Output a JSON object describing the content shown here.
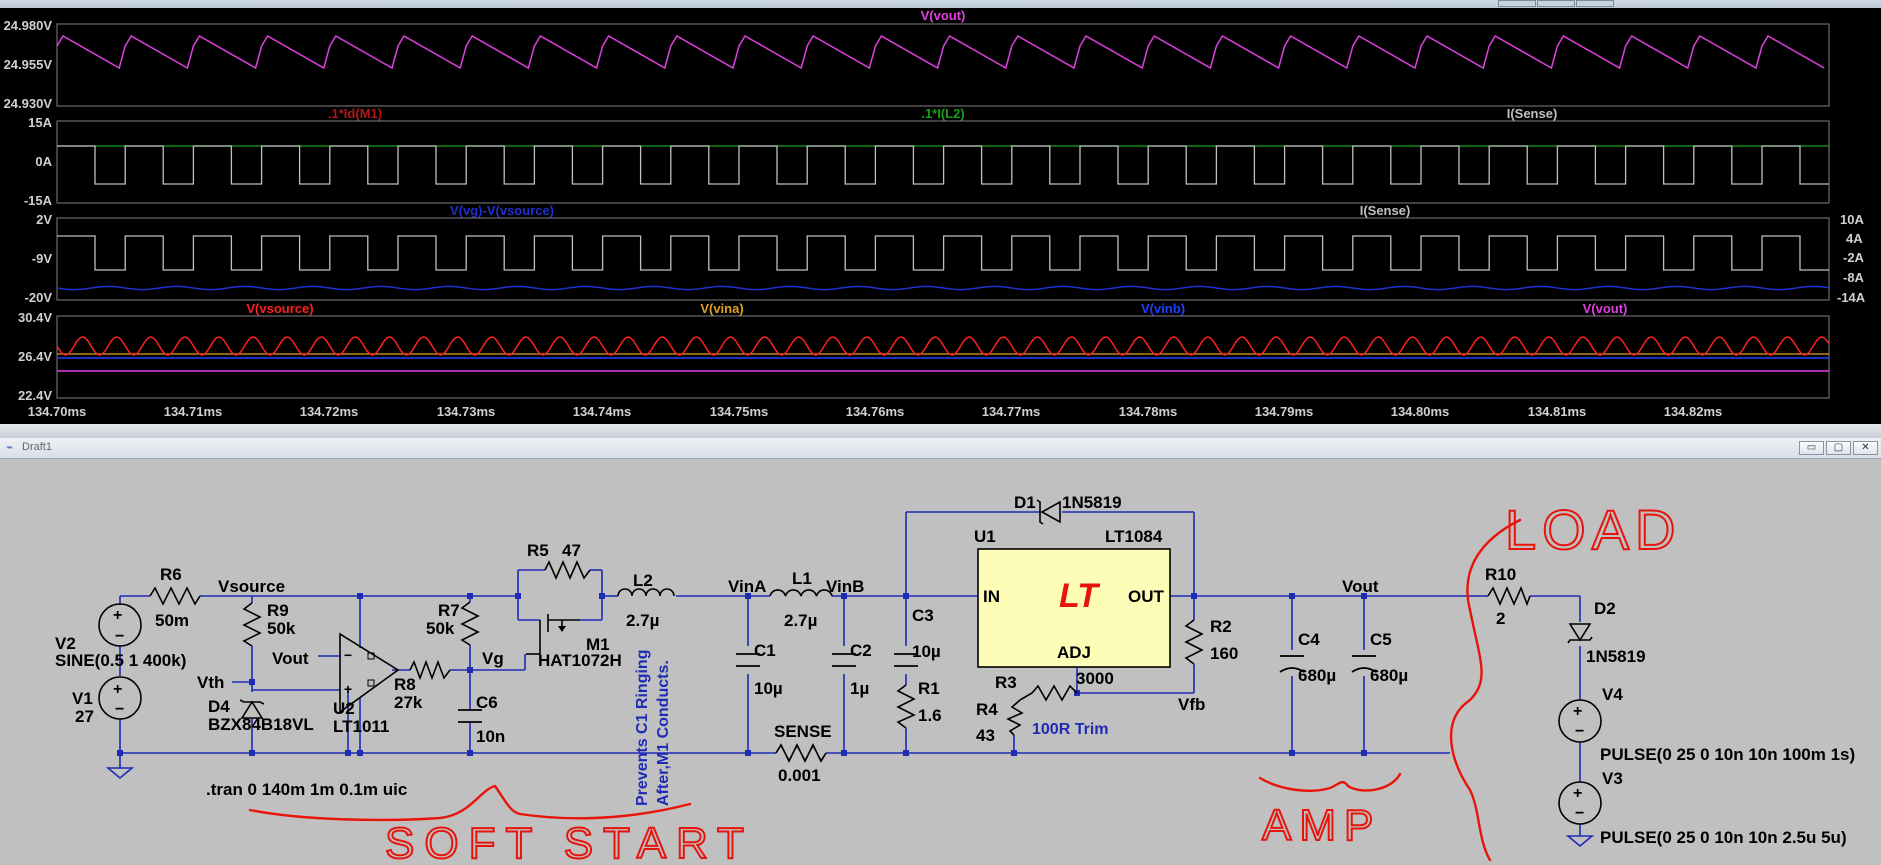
{
  "waveform_window": {
    "pane1": {
      "trace_labels": [
        "V(vout)"
      ],
      "y_ticks": [
        "24.980V",
        "24.955V",
        "24.930V"
      ]
    },
    "pane2": {
      "trace_labels": [
        ".1*Id(M1)",
        ".1*I(L2)",
        "I(Sense)"
      ],
      "y_ticks": [
        "15A",
        "0A",
        "-15A"
      ]
    },
    "pane3": {
      "trace_labels": [
        "V(vg)-V(vsource)",
        "I(Sense)"
      ],
      "y_ticks": [
        "2V",
        "-9V",
        "-20V"
      ],
      "y2_ticks": [
        "10A",
        "4A",
        "-2A",
        "-8A",
        "-14A"
      ]
    },
    "pane4": {
      "trace_labels": [
        "V(vsource)",
        "V(vina)",
        "V(vinb)",
        "V(vout)"
      ],
      "y_ticks": [
        "30.4V",
        "26.4V",
        "22.4V"
      ]
    },
    "x_ticks": [
      "134.70ms",
      "134.71ms",
      "134.72ms",
      "134.73ms",
      "134.74ms",
      "134.75ms",
      "134.76ms",
      "134.77ms",
      "134.78ms",
      "134.79ms",
      "134.80ms",
      "134.81ms",
      "134.82ms"
    ],
    "colors": {
      "vout": "#e040e0",
      "id_m1": "#b01818",
      "i_l2": "#18a018",
      "i_sense": "#c0c0c0",
      "vg_vsource": "#2030d0",
      "vsource": "#ff2020",
      "vina": "#e0a020",
      "vinb": "#2040ff"
    }
  },
  "schematic_window": {
    "title": "Draft1",
    "controls": [
      "▭",
      "▢",
      "✕"
    ],
    "components": {
      "R6": {
        "name": "R6",
        "value": "50m"
      },
      "R9": {
        "name": "R9",
        "value": "50k"
      },
      "R7": {
        "name": "R7",
        "value": "50k"
      },
      "R8": {
        "name": "R8",
        "value": "27k"
      },
      "R5": {
        "name": "R5",
        "value": "47"
      },
      "M1": {
        "name": "M1",
        "value": "HAT1072H"
      },
      "L2": {
        "name": "L2",
        "value": "2.7µ"
      },
      "L1": {
        "name": "L1",
        "value": "2.7µ"
      },
      "C1": {
        "name": "C1",
        "value": "10µ"
      },
      "C2": {
        "name": "C2",
        "value": "1µ"
      },
      "C3": {
        "name": "C3",
        "value": "10µ"
      },
      "C6": {
        "name": "C6",
        "value": "10n"
      },
      "C4": {
        "name": "C4",
        "value": "680µ"
      },
      "C5": {
        "name": "C5",
        "value": "680µ"
      },
      "R1": {
        "name": "R1",
        "value": "1.6"
      },
      "R2": {
        "name": "R2",
        "value": "160"
      },
      "R3": {
        "name": "R3",
        "value": "3000"
      },
      "R4": {
        "name": "R4",
        "value": "43"
      },
      "R10": {
        "name": "R10",
        "value": "2"
      },
      "D1": {
        "name": "D1",
        "value": "1N5819"
      },
      "D2": {
        "name": "D2",
        "value": "1N5819"
      },
      "D4": {
        "name": "D4",
        "value": "BZX84B18VL"
      },
      "U1": {
        "name": "U1",
        "value": "LT1084",
        "pin_in": "IN",
        "pin_out": "OUT",
        "pin_adj": "ADJ"
      },
      "U2": {
        "name": "U2",
        "value": "LT1011"
      },
      "V1": {
        "name": "V1",
        "value": "27"
      },
      "V2": {
        "name": "V2",
        "value": "SINE(0.5 1 400k)"
      },
      "V3": {
        "name": "V3",
        "value": "PULSE(0 25 0 10n 10n 2.5u 5u)"
      },
      "V4": {
        "name": "V4",
        "value": "PULSE(0 25 0 10n 10n 100m 1s)"
      },
      "SENSE": {
        "name": "SENSE",
        "value": "0.001"
      }
    },
    "net_labels": {
      "vsource": "Vsource",
      "vout_opamp": "Vout",
      "vth": "Vth",
      "vg": "Vg",
      "vina": "VinA",
      "vinb": "VinB",
      "vout": "Vout",
      "vfb": "Vfb"
    },
    "spice_directive": ".tran 0 140m 1m 0.1m uic",
    "comments": {
      "ringing": "Prevents C1 Ringing",
      "ringing2": "After,M1 Conducts.",
      "trim": "100R Trim"
    },
    "handwritten": {
      "soft_start": "SOFT START",
      "amp": "AMP",
      "load": "LOAD"
    }
  }
}
